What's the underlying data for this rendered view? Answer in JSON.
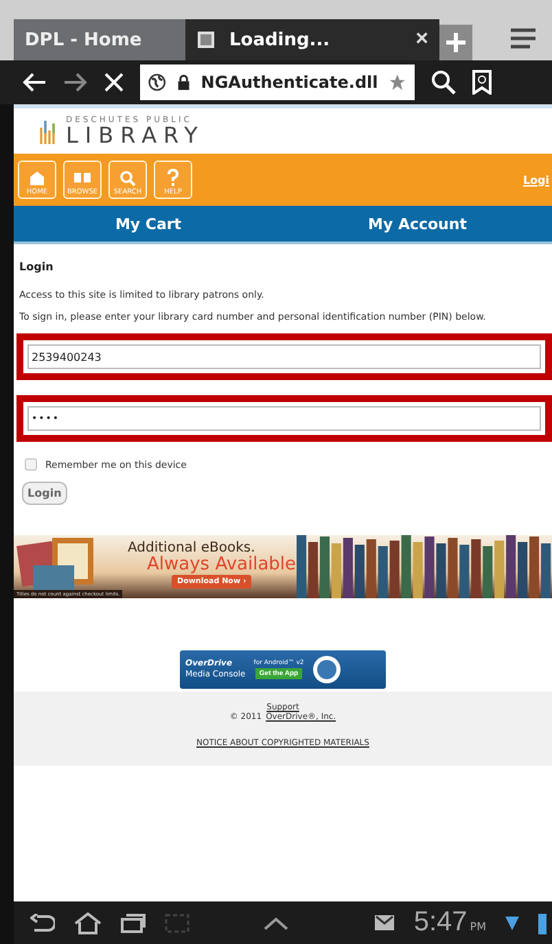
{
  "browser": {
    "tabs": [
      {
        "title": "DPL - Home",
        "selected": false
      },
      {
        "title": "Loading...",
        "selected": true
      }
    ],
    "close": "×",
    "url": "NGAuthenticate.dll"
  },
  "logo": {
    "top": "DESCHUTES PUBLIC",
    "bottom": "LIBRARY"
  },
  "nav_buttons": [
    {
      "label": "HOME",
      "kind": "home"
    },
    {
      "label": "BROWSE",
      "kind": "browse"
    },
    {
      "label": "SEARCH",
      "kind": "search"
    },
    {
      "label": "HELP",
      "kind": "help"
    }
  ],
  "nav_right": "Logi",
  "tabs": [
    {
      "label": "My Cart"
    },
    {
      "label": "My Account"
    }
  ],
  "login": {
    "title": "Login",
    "notice": "Access to this site is limited to library patrons only.",
    "instructions": "To sign in, please enter your library card number and personal identification number (PIN) below.",
    "fields": [
      {
        "kind": "text",
        "value": "2539400243",
        "highlighted": true
      },
      {
        "kind": "password",
        "value": "••••",
        "highlighted": true
      }
    ],
    "remember": {
      "label": "Remember me on this device",
      "checked": false
    },
    "button": "Login"
  },
  "banner": {
    "headline": "Additional eBooks.",
    "tagline": "Always Available",
    "button": "Download Now ›",
    "note": "Titles do not count against checkout limits."
  },
  "app_badge": {
    "brand": "OverDrive",
    "product": "Media Console",
    "platform": "for Android™ v2",
    "button": "Get the App"
  },
  "footer": {
    "support": "Support",
    "copyright": "© 2011",
    "company": "OverDrive®, Inc.",
    "notice": "NOTICE ABOUT COPYRIGHTED MATERIALS"
  },
  "status_bar": {
    "time": "5:47",
    "ampm": "PM"
  }
}
